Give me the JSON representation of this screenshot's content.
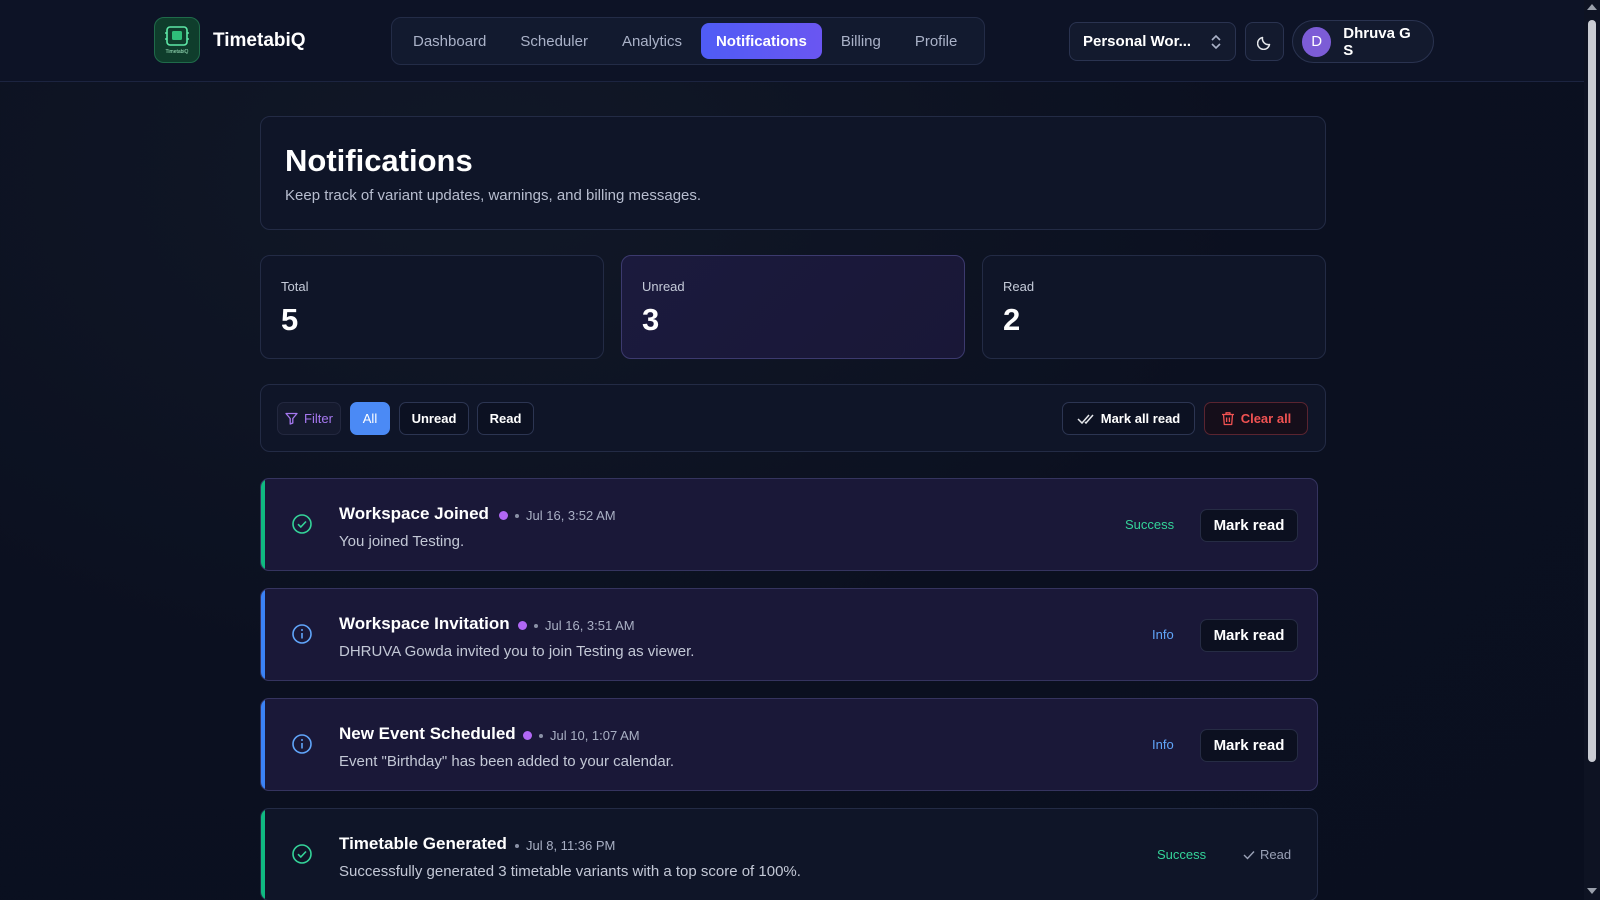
{
  "app": {
    "name": "TimetabiQ",
    "logo_caption": "TimetabiQ"
  },
  "nav": {
    "items": [
      {
        "label": "Dashboard",
        "active": false
      },
      {
        "label": "Scheduler",
        "active": false
      },
      {
        "label": "Analytics",
        "active": false
      },
      {
        "label": "Notifications",
        "active": true
      },
      {
        "label": "Billing",
        "active": false
      },
      {
        "label": "Profile",
        "active": false
      }
    ]
  },
  "workspace": {
    "selected": "Personal Wor..."
  },
  "user": {
    "initial": "D",
    "name": "Dhruva G S"
  },
  "header": {
    "title": "Notifications",
    "subtitle": "Keep track of variant updates, warnings, and billing messages."
  },
  "stats": {
    "total": {
      "label": "Total",
      "value": "5"
    },
    "unread": {
      "label": "Unread",
      "value": "3"
    },
    "read": {
      "label": "Read",
      "value": "2"
    }
  },
  "filters": {
    "filter_label": "Filter",
    "all_label": "All",
    "unread_label": "Unread",
    "read_label": "Read",
    "mark_all_label": "Mark all read",
    "clear_all_label": "Clear all"
  },
  "notifications": [
    {
      "title": "Workspace Joined",
      "unread": true,
      "time": "Jul 16, 3:52 AM",
      "message": "You joined Testing.",
      "type": "Success",
      "action": "Mark read"
    },
    {
      "title": "Workspace Invitation",
      "unread": true,
      "time": "Jul 16, 3:51 AM",
      "message": "DHRUVA Gowda invited you to join Testing as viewer.",
      "type": "Info",
      "action": "Mark read"
    },
    {
      "title": "New Event Scheduled",
      "unread": true,
      "time": "Jul 10, 1:07 AM",
      "message": "Event \"Birthday\" has been added to your calendar.",
      "type": "Info",
      "action": "Mark read"
    },
    {
      "title": "Timetable Generated",
      "unread": false,
      "time": "Jul 8, 11:36 PM",
      "message": "Successfully generated 3 timetable variants with a top score of 100%.",
      "type": "Success",
      "read_label": "Read"
    }
  ],
  "colors": {
    "accent": "#5b5bf7",
    "success": "#34d399",
    "info": "#60a5fa",
    "danger": "#f05252",
    "unread_dot": "#b167f5"
  }
}
